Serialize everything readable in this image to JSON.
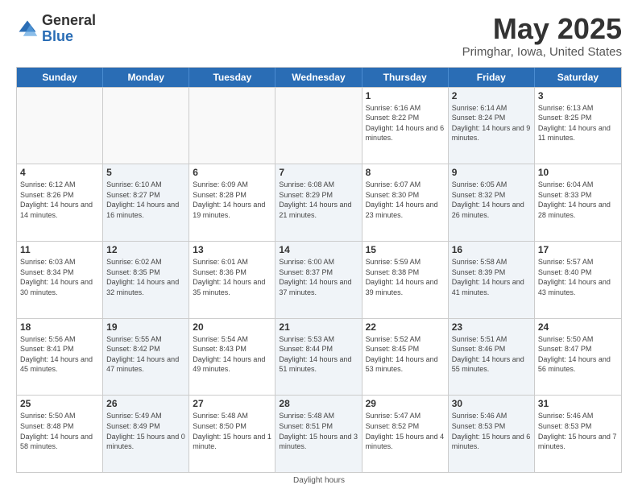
{
  "header": {
    "logo_general": "General",
    "logo_blue": "Blue",
    "title": "May 2025",
    "subtitle": "Primghar, Iowa, United States"
  },
  "calendar": {
    "days_of_week": [
      "Sunday",
      "Monday",
      "Tuesday",
      "Wednesday",
      "Thursday",
      "Friday",
      "Saturday"
    ],
    "rows": [
      [
        {
          "day": "",
          "info": "",
          "empty": true
        },
        {
          "day": "",
          "info": "",
          "empty": true
        },
        {
          "day": "",
          "info": "",
          "empty": true
        },
        {
          "day": "",
          "info": "",
          "empty": true
        },
        {
          "day": "1",
          "info": "Sunrise: 6:16 AM\nSunset: 8:22 PM\nDaylight: 14 hours and 6 minutes.",
          "empty": false,
          "shaded": false
        },
        {
          "day": "2",
          "info": "Sunrise: 6:14 AM\nSunset: 8:24 PM\nDaylight: 14 hours and 9 minutes.",
          "empty": false,
          "shaded": true
        },
        {
          "day": "3",
          "info": "Sunrise: 6:13 AM\nSunset: 8:25 PM\nDaylight: 14 hours and 11 minutes.",
          "empty": false,
          "shaded": false
        }
      ],
      [
        {
          "day": "4",
          "info": "Sunrise: 6:12 AM\nSunset: 8:26 PM\nDaylight: 14 hours and 14 minutes.",
          "empty": false,
          "shaded": false
        },
        {
          "day": "5",
          "info": "Sunrise: 6:10 AM\nSunset: 8:27 PM\nDaylight: 14 hours and 16 minutes.",
          "empty": false,
          "shaded": true
        },
        {
          "day": "6",
          "info": "Sunrise: 6:09 AM\nSunset: 8:28 PM\nDaylight: 14 hours and 19 minutes.",
          "empty": false,
          "shaded": false
        },
        {
          "day": "7",
          "info": "Sunrise: 6:08 AM\nSunset: 8:29 PM\nDaylight: 14 hours and 21 minutes.",
          "empty": false,
          "shaded": true
        },
        {
          "day": "8",
          "info": "Sunrise: 6:07 AM\nSunset: 8:30 PM\nDaylight: 14 hours and 23 minutes.",
          "empty": false,
          "shaded": false
        },
        {
          "day": "9",
          "info": "Sunrise: 6:05 AM\nSunset: 8:32 PM\nDaylight: 14 hours and 26 minutes.",
          "empty": false,
          "shaded": true
        },
        {
          "day": "10",
          "info": "Sunrise: 6:04 AM\nSunset: 8:33 PM\nDaylight: 14 hours and 28 minutes.",
          "empty": false,
          "shaded": false
        }
      ],
      [
        {
          "day": "11",
          "info": "Sunrise: 6:03 AM\nSunset: 8:34 PM\nDaylight: 14 hours and 30 minutes.",
          "empty": false,
          "shaded": false
        },
        {
          "day": "12",
          "info": "Sunrise: 6:02 AM\nSunset: 8:35 PM\nDaylight: 14 hours and 32 minutes.",
          "empty": false,
          "shaded": true
        },
        {
          "day": "13",
          "info": "Sunrise: 6:01 AM\nSunset: 8:36 PM\nDaylight: 14 hours and 35 minutes.",
          "empty": false,
          "shaded": false
        },
        {
          "day": "14",
          "info": "Sunrise: 6:00 AM\nSunset: 8:37 PM\nDaylight: 14 hours and 37 minutes.",
          "empty": false,
          "shaded": true
        },
        {
          "day": "15",
          "info": "Sunrise: 5:59 AM\nSunset: 8:38 PM\nDaylight: 14 hours and 39 minutes.",
          "empty": false,
          "shaded": false
        },
        {
          "day": "16",
          "info": "Sunrise: 5:58 AM\nSunset: 8:39 PM\nDaylight: 14 hours and 41 minutes.",
          "empty": false,
          "shaded": true
        },
        {
          "day": "17",
          "info": "Sunrise: 5:57 AM\nSunset: 8:40 PM\nDaylight: 14 hours and 43 minutes.",
          "empty": false,
          "shaded": false
        }
      ],
      [
        {
          "day": "18",
          "info": "Sunrise: 5:56 AM\nSunset: 8:41 PM\nDaylight: 14 hours and 45 minutes.",
          "empty": false,
          "shaded": false
        },
        {
          "day": "19",
          "info": "Sunrise: 5:55 AM\nSunset: 8:42 PM\nDaylight: 14 hours and 47 minutes.",
          "empty": false,
          "shaded": true
        },
        {
          "day": "20",
          "info": "Sunrise: 5:54 AM\nSunset: 8:43 PM\nDaylight: 14 hours and 49 minutes.",
          "empty": false,
          "shaded": false
        },
        {
          "day": "21",
          "info": "Sunrise: 5:53 AM\nSunset: 8:44 PM\nDaylight: 14 hours and 51 minutes.",
          "empty": false,
          "shaded": true
        },
        {
          "day": "22",
          "info": "Sunrise: 5:52 AM\nSunset: 8:45 PM\nDaylight: 14 hours and 53 minutes.",
          "empty": false,
          "shaded": false
        },
        {
          "day": "23",
          "info": "Sunrise: 5:51 AM\nSunset: 8:46 PM\nDaylight: 14 hours and 55 minutes.",
          "empty": false,
          "shaded": true
        },
        {
          "day": "24",
          "info": "Sunrise: 5:50 AM\nSunset: 8:47 PM\nDaylight: 14 hours and 56 minutes.",
          "empty": false,
          "shaded": false
        }
      ],
      [
        {
          "day": "25",
          "info": "Sunrise: 5:50 AM\nSunset: 8:48 PM\nDaylight: 14 hours and 58 minutes.",
          "empty": false,
          "shaded": false
        },
        {
          "day": "26",
          "info": "Sunrise: 5:49 AM\nSunset: 8:49 PM\nDaylight: 15 hours and 0 minutes.",
          "empty": false,
          "shaded": true
        },
        {
          "day": "27",
          "info": "Sunrise: 5:48 AM\nSunset: 8:50 PM\nDaylight: 15 hours and 1 minute.",
          "empty": false,
          "shaded": false
        },
        {
          "day": "28",
          "info": "Sunrise: 5:48 AM\nSunset: 8:51 PM\nDaylight: 15 hours and 3 minutes.",
          "empty": false,
          "shaded": true
        },
        {
          "day": "29",
          "info": "Sunrise: 5:47 AM\nSunset: 8:52 PM\nDaylight: 15 hours and 4 minutes.",
          "empty": false,
          "shaded": false
        },
        {
          "day": "30",
          "info": "Sunrise: 5:46 AM\nSunset: 8:53 PM\nDaylight: 15 hours and 6 minutes.",
          "empty": false,
          "shaded": true
        },
        {
          "day": "31",
          "info": "Sunrise: 5:46 AM\nSunset: 8:53 PM\nDaylight: 15 hours and 7 minutes.",
          "empty": false,
          "shaded": false
        }
      ]
    ]
  },
  "footer": {
    "note": "Daylight hours"
  }
}
